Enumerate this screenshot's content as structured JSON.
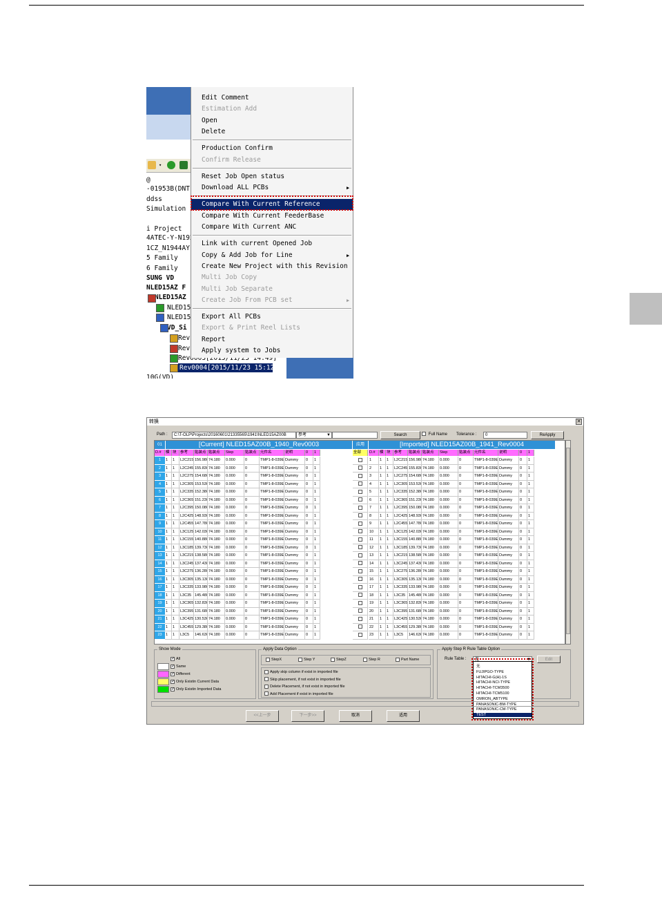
{
  "context_menu": {
    "groups": [
      [
        {
          "label": "Edit Comment",
          "disabled": false
        },
        {
          "label": "Estimation Add",
          "disabled": true
        },
        {
          "label": "Open",
          "disabled": false
        },
        {
          "label": "Delete",
          "disabled": false
        }
      ],
      [
        {
          "label": "Production Confirm",
          "disabled": false
        },
        {
          "label": "Confirm Release",
          "disabled": true
        }
      ],
      [
        {
          "label": "Reset Job Open status",
          "disabled": false
        },
        {
          "label": "Download ALL PCBs",
          "disabled": false,
          "submenu": true
        }
      ],
      [
        {
          "label": "Compare With Current Reference",
          "disabled": false,
          "selected": true
        },
        {
          "label": "Compare With Current FeederBase",
          "disabled": false
        },
        {
          "label": "Compare With Current ANC",
          "disabled": false
        }
      ],
      [
        {
          "label": "Link with current Opened Job",
          "disabled": false
        },
        {
          "label": "Copy & Add Job for Line",
          "disabled": false,
          "submenu": true
        },
        {
          "label": "Create New Project with this Revision",
          "disabled": false
        },
        {
          "label": "Multi Job Copy",
          "disabled": true
        },
        {
          "label": "Multi Job Separate",
          "disabled": true
        },
        {
          "label": "Create Job From PCB set",
          "disabled": true,
          "submenu": true
        }
      ],
      [
        {
          "label": "Export All PCBs",
          "disabled": false
        },
        {
          "label": "Export & Print Reel Lists",
          "disabled": true
        },
        {
          "label": "Report",
          "disabled": false
        },
        {
          "label": "Apply system to Jobs",
          "disabled": false
        }
      ]
    ]
  },
  "tree": {
    "lines": [
      {
        "text": "@",
        "bold": false
      },
      {
        "text": "-01953B(DNT",
        "bold": false
      },
      {
        "text": "ddss",
        "bold": false
      },
      {
        "text": "Simulation",
        "bold": false
      },
      {
        "text": "",
        "bold": false
      },
      {
        "text": "i Project",
        "bold": false
      },
      {
        "text": "4ATEC-Y-N192",
        "bold": false
      },
      {
        "text": "1CZ_N1944AY",
        "bold": false
      },
      {
        "text": "5 Family",
        "bold": false
      },
      {
        "text": "6 Family",
        "bold": false
      },
      {
        "text": "SUNG VD",
        "bold": true
      },
      {
        "text": "NLED15AZ F",
        "bold": true
      },
      {
        "text": "NLED15AZ",
        "bold": true
      },
      {
        "text": "NLED15",
        "bold": false
      },
      {
        "text": "NLED15",
        "bold": false
      },
      {
        "text": "VD_Si",
        "bold": true
      },
      {
        "text": "Rev",
        "bold": false
      },
      {
        "text": "Rev",
        "bold": false
      },
      {
        "text": "Rev0003[2015/11/23 14:49]",
        "bold": false
      },
      {
        "text": "Rev0004[2015/11/23 15:12]",
        "bold": false,
        "selected": true
      },
      {
        "text": "10G(VD)",
        "bold": false
      }
    ]
  },
  "dialog": {
    "title": "转换",
    "path_label": "Path :",
    "path_value": "C:\\T-OLP\\Projects\\20160601\\21335565\\1941\\NLED15AZ00B",
    "ref_value": "参考",
    "search_label": "Search",
    "fullname_label": "Full Name",
    "tolerance_label": "Tolerance :",
    "tolerance_value": "0",
    "reapply_label": "ReApply",
    "current_title": "[Current] NLED15AZ00B_1940_Rev0003",
    "imported_title": "[Imported] NLED15AZ00B_1941_Rev0004",
    "mid_header": "应用",
    "all_label": "全部",
    "row_corner": "01",
    "columns": [
      "D.#",
      "模",
      "块",
      "参考",
      "贴装点",
      "贴装点",
      "Step",
      "贴装点",
      "元件名",
      "说明",
      "0",
      "1"
    ],
    "rows": [
      [
        "1",
        "1",
        "1",
        "L2C215",
        "156.980",
        "74.180",
        "0.000",
        "0",
        "TMP1-8-039E",
        "Dummy",
        "0",
        "1"
      ],
      [
        "2",
        "1",
        "1",
        "L2C245",
        "155.830",
        "74.180",
        "0.000",
        "0",
        "TMP1-8-039E",
        "Dummy",
        "0",
        "1"
      ],
      [
        "3",
        "1",
        "1",
        "L2C275",
        "154.680",
        "74.180",
        "0.000",
        "0",
        "TMP1-8-039E",
        "Dummy",
        "0",
        "1"
      ],
      [
        "4",
        "1",
        "1",
        "L2C305",
        "153.530",
        "74.180",
        "0.000",
        "0",
        "TMP1-8-039E",
        "Dummy",
        "0",
        "1"
      ],
      [
        "5",
        "1",
        "1",
        "L2C335",
        "152.380",
        "74.180",
        "0.000",
        "0",
        "TMP1-8-039E",
        "Dummy",
        "0",
        "1"
      ],
      [
        "6",
        "1",
        "1",
        "L2C365",
        "151.230",
        "74.180",
        "0.000",
        "0",
        "TMP1-8-039E",
        "Dummy",
        "0",
        "1"
      ],
      [
        "7",
        "1",
        "1",
        "L2C395",
        "150.080",
        "74.180",
        "0.000",
        "0",
        "TMP1-8-039E",
        "Dummy",
        "0",
        "1"
      ],
      [
        "8",
        "1",
        "1",
        "L2C425",
        "148.930",
        "74.180",
        "0.000",
        "0",
        "TMP1-8-039E",
        "Dummy",
        "0",
        "1"
      ],
      [
        "9",
        "1",
        "1",
        "L2C455",
        "147.780",
        "74.180",
        "0.000",
        "0",
        "TMP1-8-039E",
        "Dummy",
        "0",
        "1"
      ],
      [
        "10",
        "1",
        "1",
        "L3C125",
        "142.030",
        "74.180",
        "0.000",
        "0",
        "TMP1-8-039E",
        "Dummy",
        "0",
        "1"
      ],
      [
        "11",
        "1",
        "1",
        "L3C155",
        "140.880",
        "74.180",
        "0.000",
        "0",
        "TMP1-8-039E",
        "Dummy",
        "0",
        "1"
      ],
      [
        "12",
        "1",
        "1",
        "L3C185",
        "139.730",
        "74.180",
        "0.000",
        "0",
        "TMP1-8-039E",
        "Dummy",
        "0",
        "1"
      ],
      [
        "13",
        "1",
        "1",
        "L3C215",
        "138.580",
        "74.180",
        "0.000",
        "0",
        "TMP1-8-039E",
        "Dummy",
        "0",
        "1"
      ],
      [
        "14",
        "1",
        "1",
        "L3C245",
        "137.430",
        "74.180",
        "0.000",
        "0",
        "TMP1-8-039E",
        "Dummy",
        "0",
        "1"
      ],
      [
        "15",
        "1",
        "1",
        "L3C275",
        "136.280",
        "74.180",
        "0.000",
        "0",
        "TMP1-8-039E",
        "Dummy",
        "0",
        "1"
      ],
      [
        "16",
        "1",
        "1",
        "L3C305",
        "135.130",
        "74.180",
        "0.000",
        "0",
        "TMP1-8-039E",
        "Dummy",
        "0",
        "1"
      ],
      [
        "17",
        "1",
        "1",
        "L3C335",
        "133.980",
        "74.180",
        "0.000",
        "0",
        "TMP1-8-039E",
        "Dummy",
        "0",
        "1"
      ],
      [
        "18",
        "1",
        "1",
        "L3C35",
        "145.480",
        "74.180",
        "0.000",
        "0",
        "TMP1-8-039E",
        "Dummy",
        "0",
        "1"
      ],
      [
        "19",
        "1",
        "1",
        "L3C365",
        "132.830",
        "74.180",
        "0.000",
        "0",
        "TMP1-8-039E",
        "Dummy",
        "0",
        "1"
      ],
      [
        "20",
        "1",
        "1",
        "L3C395",
        "131.680",
        "74.180",
        "0.000",
        "0",
        "TMP1-8-039E",
        "Dummy",
        "0",
        "1"
      ],
      [
        "21",
        "1",
        "1",
        "L3C425",
        "130.530",
        "74.180",
        "0.000",
        "0",
        "TMP1-8-039E",
        "Dummy",
        "0",
        "1"
      ],
      [
        "22",
        "1",
        "1",
        "L3C455",
        "129.380",
        "74.180",
        "0.000",
        "0",
        "TMP1-8-039E",
        "Dummy",
        "0",
        "1"
      ],
      [
        "23",
        "1",
        "1",
        "L3C5",
        "146.630",
        "74.180",
        "0.000",
        "0",
        "TMP1-8-039E",
        "Dummy",
        "0",
        "1"
      ]
    ],
    "show_mode": {
      "title": "Show Mode",
      "items": [
        {
          "label": "All",
          "color": ""
        },
        {
          "label": "Same",
          "color": "#ffffff"
        },
        {
          "label": "Different",
          "color": "#ff66ff"
        },
        {
          "label": "Only Existin Current Data",
          "color": "#ffff66"
        },
        {
          "label": "Only Existin Imported Data",
          "color": "#00e000"
        }
      ]
    },
    "apply_data": {
      "title": "Apply Data Option",
      "steps": [
        "StepX",
        "Step Y",
        "StepZ",
        "Step R",
        "Part Name"
      ],
      "options": [
        "Apply skip column if exist in imported file",
        "Skip placement, if not exist in imported file",
        "Delete Placement, if not exist in imported file",
        "Add Placement if exist in imported file"
      ]
    },
    "rule_option": {
      "title": "Apply Step R Rule Table Option",
      "rule_label": "Rule Table :",
      "rule_value": "无",
      "edit_label": "Edit",
      "options": [
        "无",
        "FUJIPGO-TYPE",
        "HITACHI-G(H)-1S",
        "HITACHI-NCI-TYPE",
        "HITACHI-TCM3500",
        "HITACHI-TCM5100",
        "OMRON_ABTYPE",
        "PANASONIC-BM-TYPE",
        "PANASONIC-CM-TYPE",
        "TEST"
      ],
      "selected_index": 9
    },
    "footer_buttons": {
      "prev": "<<上一步",
      "next": "下一步>>",
      "cancel": "取消",
      "apply": "适用"
    }
  }
}
